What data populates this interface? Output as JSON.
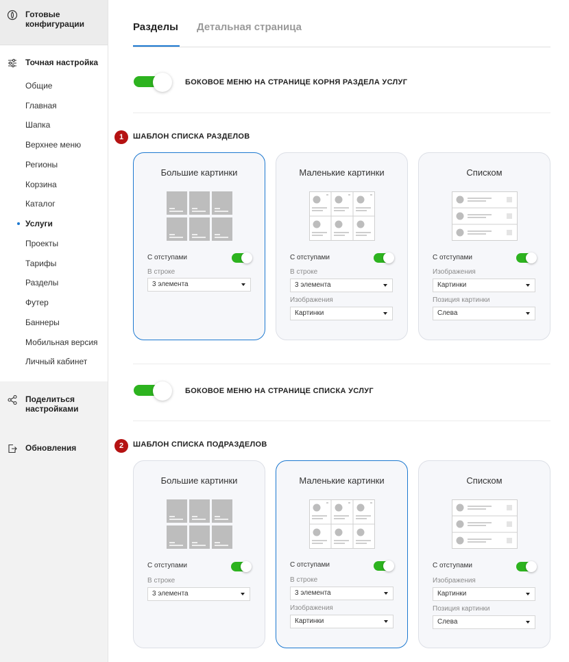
{
  "sidebar": {
    "ready_configs": "Готовые конфигурации",
    "fine_tune": "Точная настройка",
    "items": [
      "Общие",
      "Главная",
      "Шапка",
      "Верхнее меню",
      "Регионы",
      "Корзина",
      "Каталог",
      "Услуги",
      "Проекты",
      "Тарифы",
      "Разделы",
      "Футер",
      "Баннеры",
      "Мобильная версия",
      "Личный кабинет"
    ],
    "active_item": "Услуги",
    "share": "Поделиться настройками",
    "updates": "Обновления"
  },
  "tabs": [
    "Разделы",
    "Детальная страница"
  ],
  "toggle1_label": "БОКОВОЕ МЕНЮ НА СТРАНИЦЕ КОРНЯ РАЗДЕЛА УСЛУГ",
  "toggle2_label": "БОКОВОЕ МЕНЮ НА СТРАНИЦЕ СПИСКА УСЛУГ",
  "section1": {
    "badge": "1",
    "title": "ШАБЛОН СПИСКА РАЗДЕЛОВ",
    "cards": [
      {
        "title": "Большие картинки",
        "padding_label": "С отступами",
        "field1_label": "В строке",
        "field1_value": "3 элемента"
      },
      {
        "title": "Маленькие картинки",
        "padding_label": "С отступами",
        "field1_label": "В строке",
        "field1_value": "3 элемента",
        "field2_label": "Изображения",
        "field2_value": "Картинки"
      },
      {
        "title": "Списком",
        "padding_label": "С отступами",
        "field1_label": "Изображения",
        "field1_value": "Картинки",
        "field2_label": "Позиция картинки",
        "field2_value": "Слева"
      }
    ]
  },
  "section2": {
    "badge": "2",
    "title": "ШАБЛОН СПИСКА ПОДРАЗДЕЛОВ",
    "cards": [
      {
        "title": "Большие картинки",
        "padding_label": "С отступами",
        "field1_label": "В строке",
        "field1_value": "3 элемента"
      },
      {
        "title": "Маленькие картинки",
        "padding_label": "С отступами",
        "field1_label": "В строке",
        "field1_value": "3 элемента",
        "field2_label": "Изображения",
        "field2_value": "Картинки"
      },
      {
        "title": "Списком",
        "padding_label": "С отступами",
        "field1_label": "Изображения",
        "field1_value": "Картинки",
        "field2_label": "Позиция картинки",
        "field2_value": "Слева"
      }
    ]
  },
  "colors": {
    "accent": "#1b78d0",
    "toggle_on": "#2db31f",
    "badge": "#b51212"
  }
}
